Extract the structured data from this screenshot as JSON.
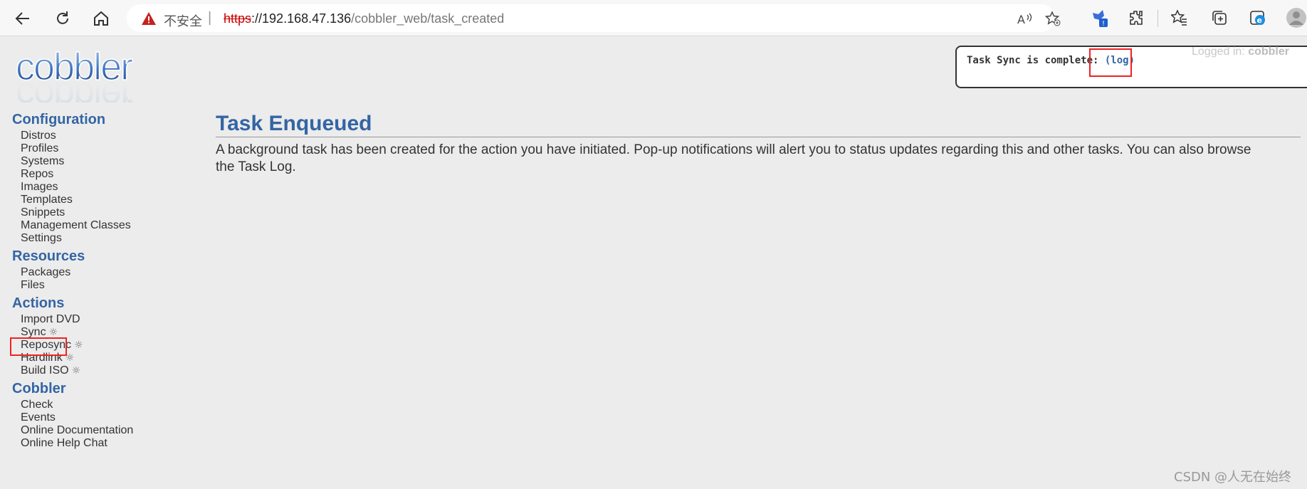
{
  "browser": {
    "insecure_label": "不安全",
    "separator": "|",
    "url_scheme": "https",
    "url_host": "://192.168.47.136",
    "url_path": "/cobbler_web/task_created",
    "toolbar_icons": [
      "back-icon",
      "refresh-icon",
      "home-icon",
      "read-aloud-icon",
      "add-favorite-icon",
      "extension-badge-icon",
      "extensions-icon",
      "favorites-icon",
      "collections-icon",
      "edge-icon",
      "profile-icon"
    ],
    "badge_text": "!"
  },
  "logo": {
    "text": "cobbler"
  },
  "sidebar": {
    "configuration": {
      "title": "Configuration",
      "items": [
        "Distros",
        "Profiles",
        "Systems",
        "Repos",
        "Images",
        "Templates",
        "Snippets",
        "Management Classes",
        "Settings"
      ]
    },
    "resources": {
      "title": "Resources",
      "items": [
        "Packages",
        "Files"
      ]
    },
    "actions": {
      "title": "Actions",
      "items": [
        "Import DVD",
        "Sync",
        "Reposync",
        "Hardlink",
        "Build ISO"
      ],
      "gear": "☼"
    },
    "cobbler": {
      "title": "Cobbler",
      "items": [
        "Check",
        "Events",
        "Online Documentation",
        "Online Help Chat"
      ]
    }
  },
  "main": {
    "title": "Task Enqueued",
    "text": "A background task has been created for the action you have initiated. Pop-up notifications will alert you to status updates regarding this and other tasks. You can also browse the Task Log."
  },
  "notification": {
    "text": "Task Sync is complete:",
    "link": "(log)"
  },
  "login": {
    "label": "Logged in:",
    "user": "cobbler"
  },
  "watermark": "CSDN @人无在始终",
  "colors": {
    "heading": "#3465a4",
    "highlight": "#e22222",
    "background": "#ececec"
  }
}
